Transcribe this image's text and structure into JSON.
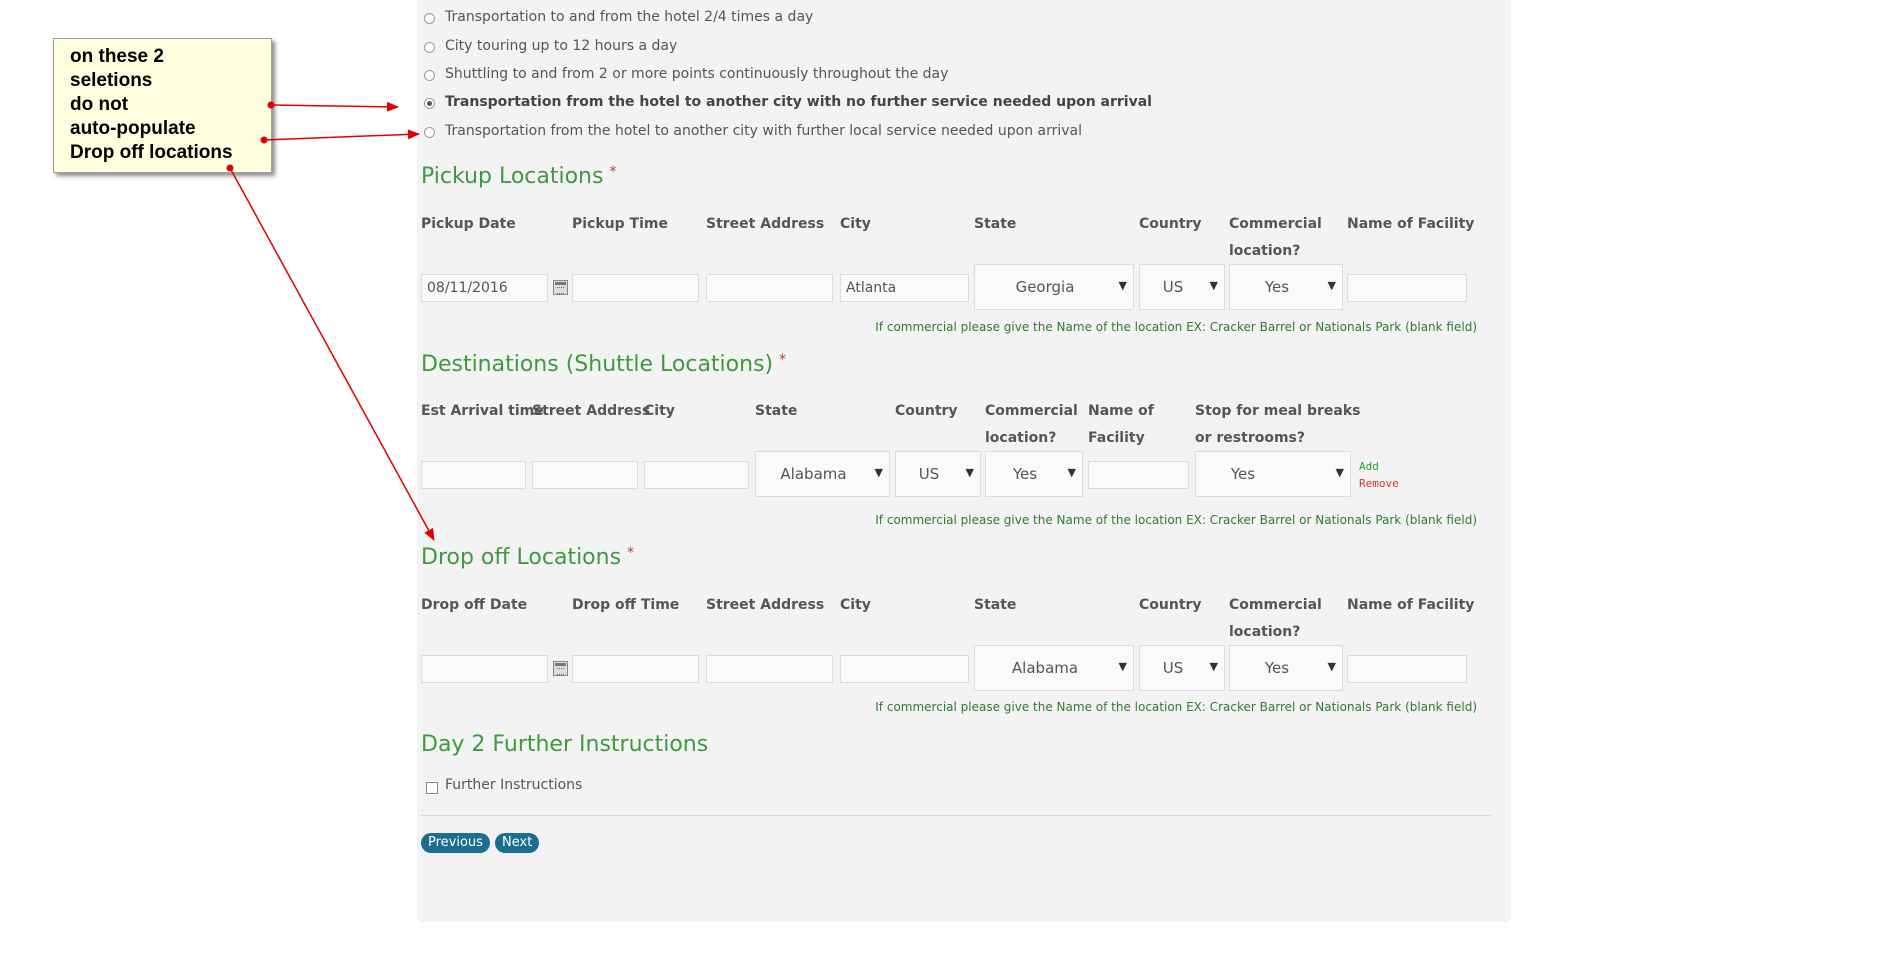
{
  "trip_types": [
    {
      "label": "Transportation to and from the hotel 2/4 times a day",
      "checked": false
    },
    {
      "label": "City touring up to 12 hours a day",
      "checked": false
    },
    {
      "label": "Shuttling to and from 2 or more points continuously throughout the day",
      "checked": false
    },
    {
      "label": "Transportation from the hotel to another city with no further service needed upon arrival",
      "checked": true
    },
    {
      "label": "Transportation from the hotel to another city with further local service needed upon arrival",
      "checked": false
    }
  ],
  "pickup": {
    "title": "Pickup Locations",
    "required_mark": "*",
    "headers": {
      "date": "Pickup Date",
      "time": "Pickup Time",
      "street": "Street Address",
      "city": "City",
      "state": "State",
      "country": "Country",
      "commercial_line1": "Commercial",
      "commercial_line2": "location?",
      "facility": "Name of Facility"
    },
    "values": {
      "date": "08/11/2016",
      "time": "",
      "street": "",
      "city": "Atlanta",
      "state": "Georgia",
      "country": "US",
      "commercial": "Yes",
      "facility": ""
    },
    "hint": "If commercial please give the Name of the location EX: Cracker Barrel or Nationals Park (blank field)"
  },
  "destinations": {
    "title": "Destinations (Shuttle Locations)",
    "required_mark": "*",
    "headers": {
      "arrival": "Est Arrival time",
      "street": "Street Address",
      "city": "City",
      "state": "State",
      "country": "Country",
      "commercial_line1": "Commercial",
      "commercial_line2": "location?",
      "facility_line1": "Name of",
      "facility_line2": "Facility",
      "stop_line1": "Stop for meal breaks",
      "stop_line2": "or restrooms?"
    },
    "values": {
      "arrival": "",
      "street": "",
      "city": "",
      "state": "Alabama",
      "country": "US",
      "commercial": "Yes",
      "facility": "",
      "stop": "Yes"
    },
    "add_label": "Add",
    "remove_label": "Remove",
    "hint": "If commercial please give the Name of the location EX: Cracker Barrel or Nationals Park (blank field)"
  },
  "dropoff": {
    "title": "Drop off Locations",
    "required_mark": "*",
    "headers": {
      "date": "Drop off Date",
      "time": "Drop off Time",
      "street": "Street Address",
      "city": "City",
      "state": "State",
      "country": "Country",
      "commercial_line1": "Commercial",
      "commercial_line2": "location?",
      "facility": "Name of Facility"
    },
    "values": {
      "date": "",
      "time": "",
      "street": "",
      "city": "",
      "state": "Alabama",
      "country": "US",
      "commercial": "Yes",
      "facility": ""
    },
    "hint": "If commercial please give the Name of the location EX: Cracker Barrel or Nationals Park (blank field)"
  },
  "further": {
    "title": "Day 2 Further Instructions",
    "checkbox_label": "Further Instructions"
  },
  "nav": {
    "previous": "Previous",
    "next": "Next"
  },
  "annotation": {
    "lines": [
      "on these 2",
      "seletions",
      "do not",
      "auto-populate",
      "Drop off locations"
    ],
    "arrow_color": "#e00000"
  },
  "colors": {
    "section_title": "#3f9a3f",
    "hint": "#2e7d2e",
    "button": "#1a6f8f"
  }
}
